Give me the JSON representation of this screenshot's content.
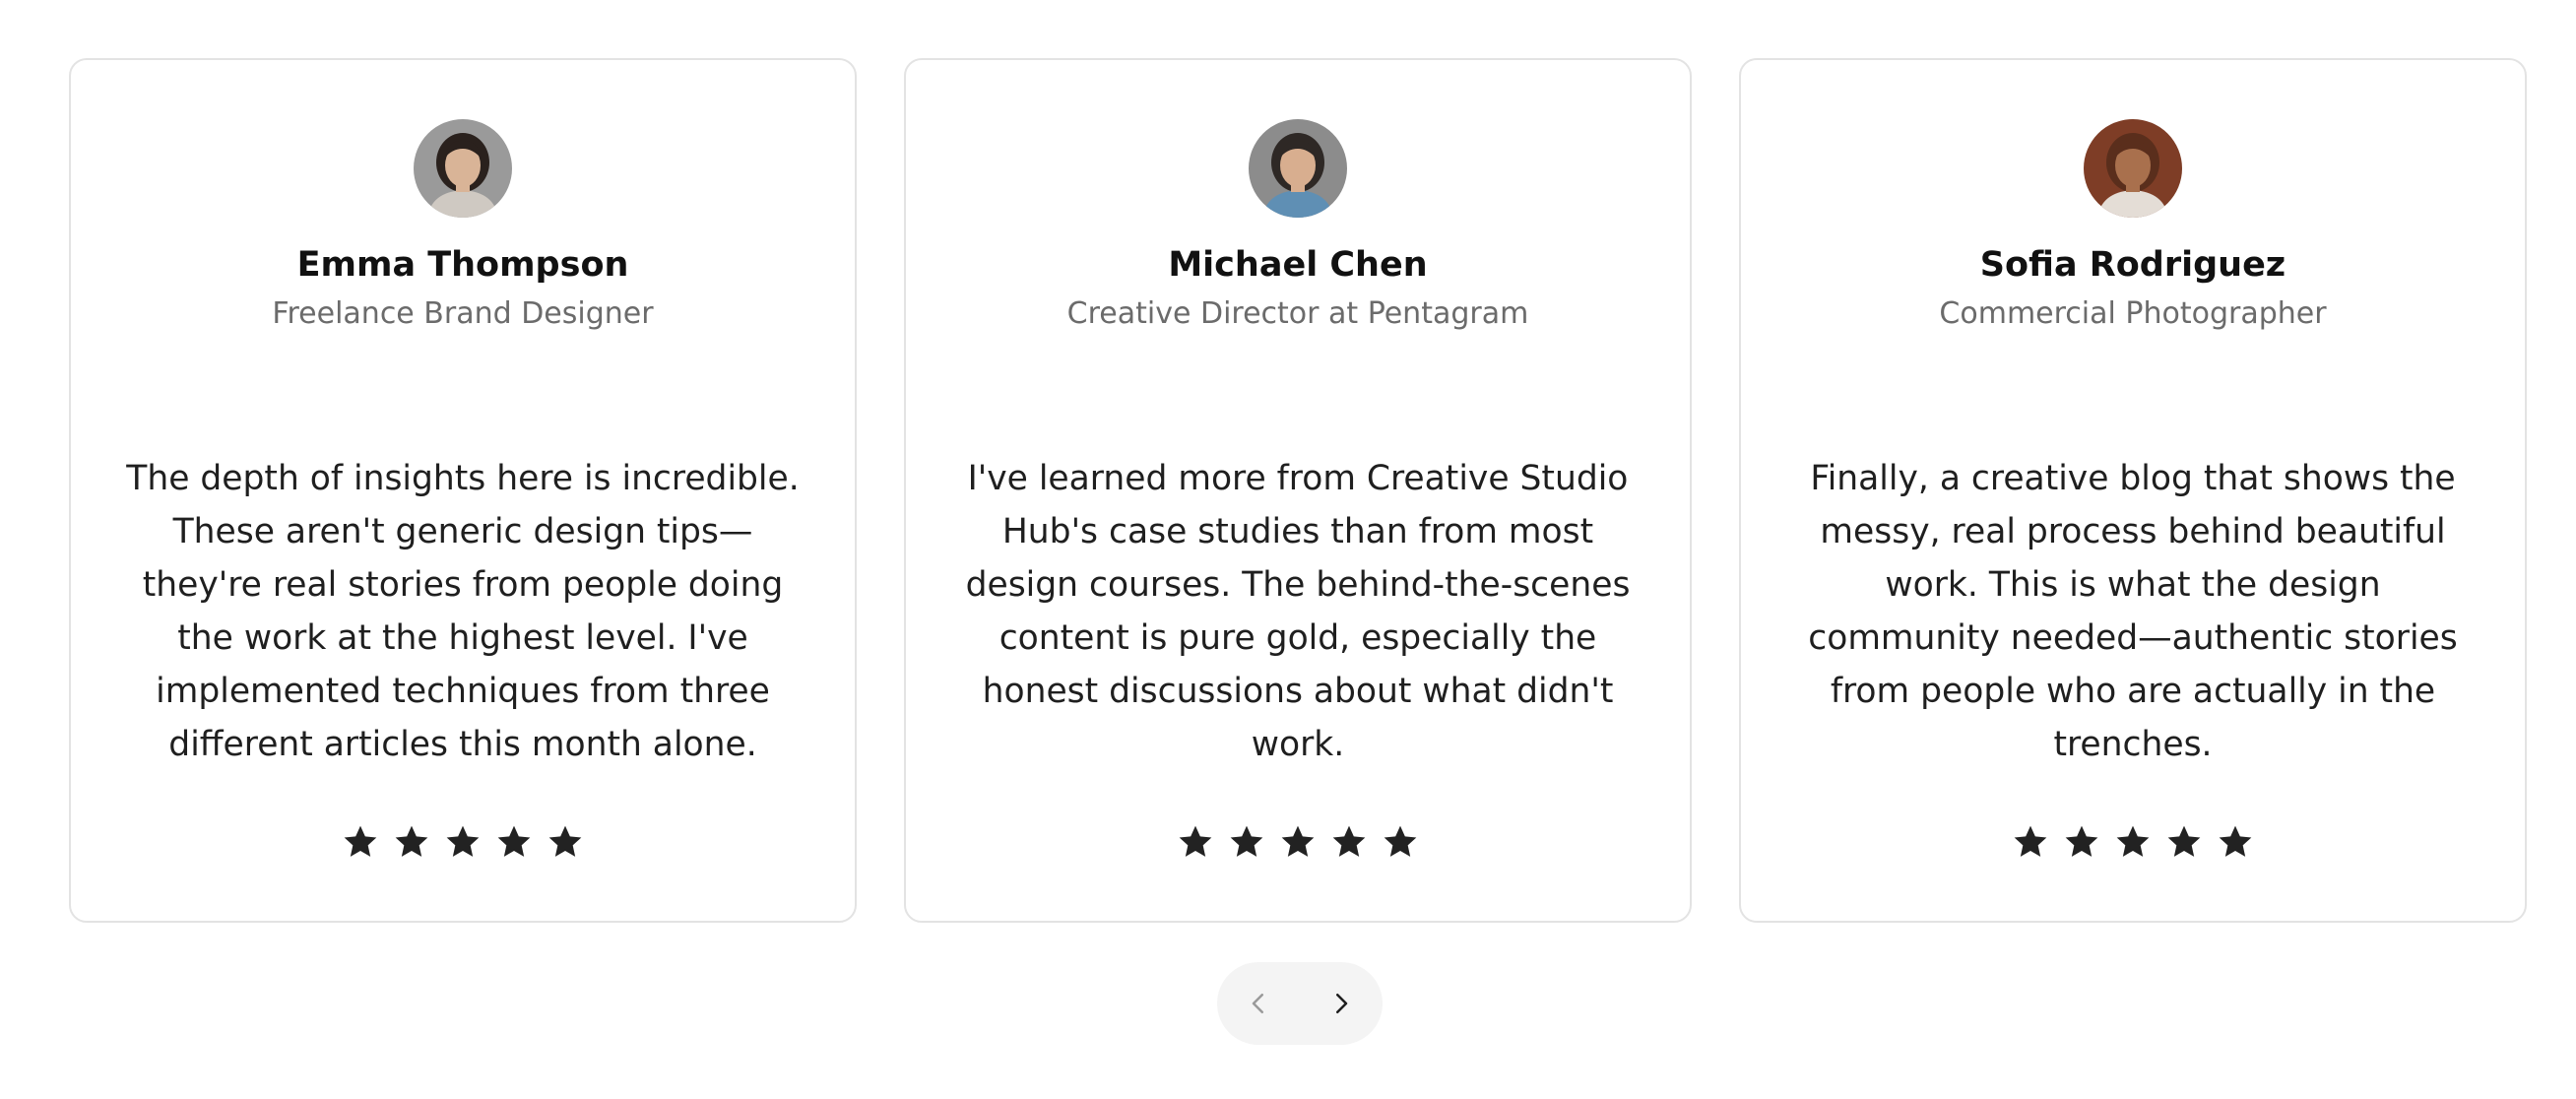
{
  "testimonials": [
    {
      "name": "Emma Thompson",
      "role": "Freelance Brand Designer",
      "quote": "The depth of insights here is incredible. These aren't generic design tips—they're real stories from people doing the work at the highest level. I've implemented techniques from three different articles this month alone.",
      "rating": 5,
      "avatar": {
        "skin": "#d9b497",
        "hair": "#2a211d",
        "bg": "#9a9a9a",
        "shirt": "#cfc9c2"
      }
    },
    {
      "name": "Michael Chen",
      "role": "Creative Director at Pentagram",
      "quote": "I've learned more from Creative Studio Hub's case studies than from most design courses. The behind-the-scenes content is pure gold, especially the honest discussions about what didn't work.",
      "rating": 5,
      "avatar": {
        "skin": "#d8ae8f",
        "hair": "#2e2825",
        "bg": "#8c8c8c",
        "shirt": "#5f8fb4"
      }
    },
    {
      "name": "Sofia Rodriguez",
      "role": "Commercial Photographer",
      "quote": "Finally, a creative blog that shows the messy, real process behind beautiful work. This is what the design community needed—authentic stories from people who are actually in the trenches.",
      "rating": 5,
      "avatar": {
        "skin": "#a9704d",
        "hair": "#5a2e1c",
        "bg": "#7e3d26",
        "shirt": "#e4ddd6"
      }
    }
  ],
  "star_color": "#222222",
  "nav": {
    "prev_icon": "chevron-left-icon",
    "next_icon": "chevron-right-icon",
    "prev_color": "#9a9a9a",
    "next_color": "#1f1f1f"
  }
}
